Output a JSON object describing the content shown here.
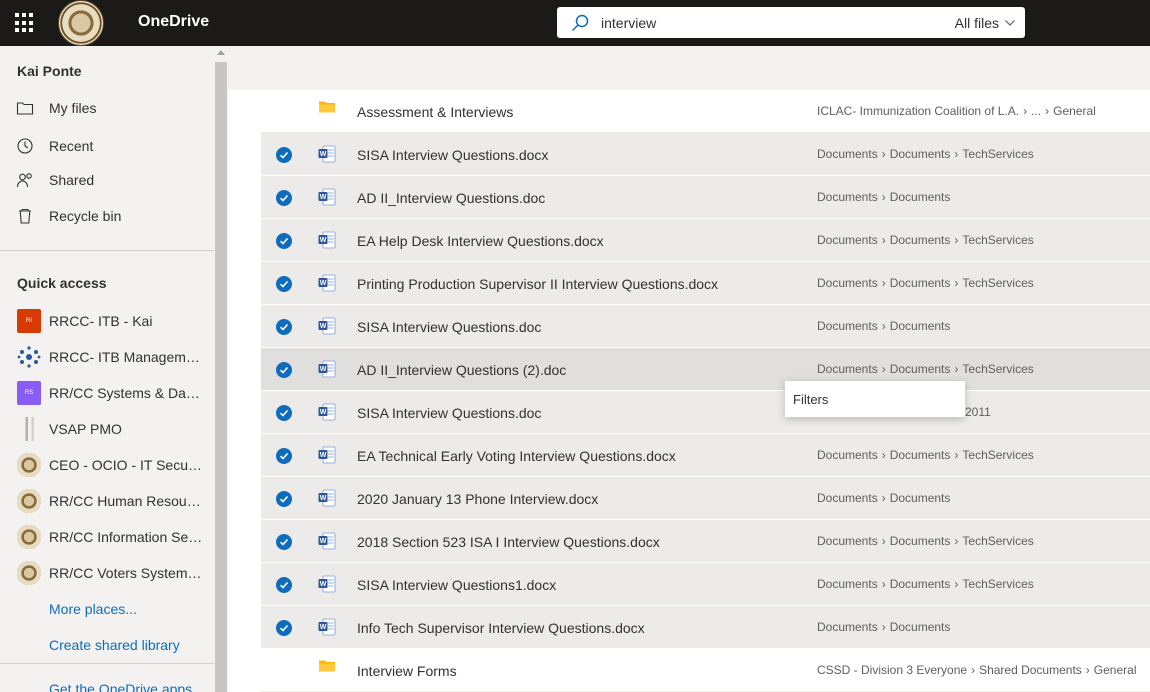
{
  "app": {
    "brand": "OneDrive"
  },
  "search": {
    "query": "interview",
    "scope": "All files"
  },
  "sidebar": {
    "user": "Kai Ponte",
    "nav": [
      {
        "label": "My files",
        "icon": "folder-icon"
      },
      {
        "label": "Recent",
        "icon": "recent-icon"
      },
      {
        "label": "Shared",
        "icon": "shared-icon"
      },
      {
        "label": "Recycle bin",
        "icon": "recycle-bin-icon"
      }
    ],
    "quick_access_title": "Quick access",
    "quick_access": [
      {
        "label": "RRCC- ITB - Kai",
        "badge": "RI",
        "color": "#d83b01"
      },
      {
        "label": "RRCC- ITB Management",
        "badge": "",
        "color": "#2b5797"
      },
      {
        "label": "RR/CC Systems & Data...",
        "badge": "RS",
        "color": "#8a5cf6"
      },
      {
        "label": "VSAP PMO",
        "badge": "",
        "color": "#c8c6c4"
      },
      {
        "label": "CEO - OCIO - IT Securi...",
        "badge": "",
        "color": "#8a6a3b"
      },
      {
        "label": "RR/CC Human Resourc...",
        "badge": "",
        "color": "#8a6a3b"
      },
      {
        "label": "RR/CC Information Sec...",
        "badge": "",
        "color": "#8a6a3b"
      },
      {
        "label": "RR/CC Voters Systems ...",
        "badge": "",
        "color": "#8a6a3b"
      }
    ],
    "more_places": "More places...",
    "create_library": "Create shared library",
    "get_apps": "Get the OneDrive apps"
  },
  "files": [
    {
      "name": "Assessment & Interviews",
      "type": "folder",
      "selected": false,
      "path": [
        "ICLAC- Immunization Coalition of L.A.",
        "...",
        "General"
      ]
    },
    {
      "name": "SISA Interview Questions.docx",
      "type": "word",
      "selected": true,
      "path": [
        "Documents",
        "Documents",
        "TechServices"
      ]
    },
    {
      "name": "AD II_Interview Questions.doc",
      "type": "word",
      "selected": true,
      "path": [
        "Documents",
        "Documents"
      ]
    },
    {
      "name": "EA Help Desk Interview Questions.docx",
      "type": "word",
      "selected": true,
      "path": [
        "Documents",
        "Documents",
        "TechServices"
      ]
    },
    {
      "name": "Printing Production Supervisor II Interview Questions.docx",
      "type": "word",
      "selected": true,
      "path": [
        "Documents",
        "Documents",
        "TechServices"
      ]
    },
    {
      "name": "SISA Interview Questions.doc",
      "type": "word",
      "selected": true,
      "path": [
        "Documents",
        "Documents"
      ]
    },
    {
      "name": "AD II_Interview Questions (2).doc",
      "type": "word",
      "selected": true,
      "path": [
        "Documents",
        "Documents",
        "TechServices"
      ]
    },
    {
      "name": "SISA Interview Questions.doc",
      "type": "word",
      "selected": true,
      "path": [
        "2011"
      ]
    },
    {
      "name": "EA Technical Early Voting Interview Questions.docx",
      "type": "word",
      "selected": true,
      "path": [
        "Documents",
        "Documents",
        "TechServices"
      ]
    },
    {
      "name": "2020 January 13 Phone Interview.docx",
      "type": "word",
      "selected": true,
      "path": [
        "Documents",
        "Documents"
      ]
    },
    {
      "name": "2018 Section 523 ISA I Interview Questions.docx",
      "type": "word",
      "selected": true,
      "path": [
        "Documents",
        "Documents",
        "TechServices"
      ]
    },
    {
      "name": "SISA Interview Questions1.docx",
      "type": "word",
      "selected": true,
      "path": [
        "Documents",
        "Documents",
        "TechServices"
      ]
    },
    {
      "name": "Info Tech Supervisor Interview Questions.docx",
      "type": "word",
      "selected": true,
      "path": [
        "Documents",
        "Documents"
      ]
    },
    {
      "name": "Interview Forms",
      "type": "folder",
      "selected": false,
      "path": [
        "CSSD - Division 3 Everyone",
        "Shared Documents",
        "General"
      ]
    }
  ],
  "tooltip": "Filters",
  "colors": {
    "topbar": "#1b1a19",
    "accent": "#0f6cbd",
    "word": "#2b579a",
    "folder": "#ffb900"
  }
}
